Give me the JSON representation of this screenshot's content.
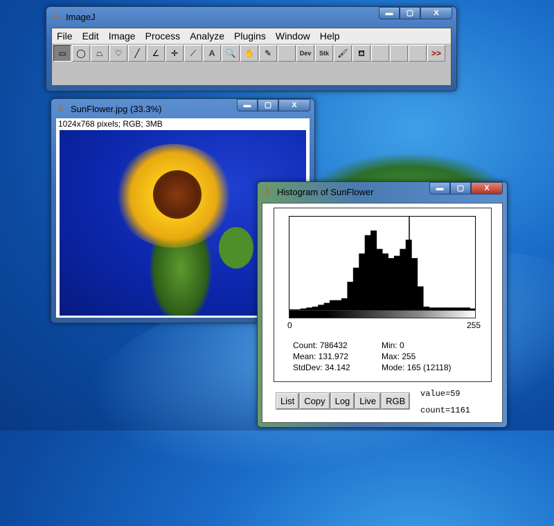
{
  "imagej": {
    "title": "ImageJ",
    "menu": [
      "File",
      "Edit",
      "Image",
      "Process",
      "Analyze",
      "Plugins",
      "Window",
      "Help"
    ],
    "tools": [
      {
        "icon": "rectangle-icon",
        "glyph": "▭"
      },
      {
        "icon": "oval-icon",
        "glyph": "◯"
      },
      {
        "icon": "polygon-icon",
        "glyph": "⏢"
      },
      {
        "icon": "freehand-icon",
        "glyph": "♡"
      },
      {
        "icon": "line-icon",
        "glyph": "╱"
      },
      {
        "icon": "angle-icon",
        "glyph": "∠"
      },
      {
        "icon": "point-icon",
        "glyph": "✛"
      },
      {
        "icon": "wand-icon",
        "glyph": "⟋"
      },
      {
        "icon": "text-icon",
        "glyph": "A"
      },
      {
        "icon": "magnifier-icon",
        "glyph": "🔍"
      },
      {
        "icon": "hand-icon",
        "glyph": "✋"
      },
      {
        "icon": "dropper-icon",
        "glyph": "✎"
      },
      {
        "icon": "empty",
        "glyph": ""
      },
      {
        "icon": "dev-icon",
        "glyph": "Dev"
      },
      {
        "icon": "stk-icon",
        "glyph": "Stk"
      },
      {
        "icon": "brush-icon",
        "glyph": "🖌"
      },
      {
        "icon": "fill-icon",
        "glyph": "⛾"
      },
      {
        "icon": "empty",
        "glyph": ""
      },
      {
        "icon": "empty",
        "glyph": ""
      },
      {
        "icon": "empty",
        "glyph": ""
      },
      {
        "icon": "more-icon",
        "glyph": ">>"
      }
    ]
  },
  "image_window": {
    "title": "SunFlower.jpg (33.3%)",
    "info": "1024x768 pixels; RGB; 3MB"
  },
  "histogram": {
    "title": "Histogram of SunFlower",
    "axis_min": "0",
    "axis_max": "255",
    "stats": {
      "count": "Count: 786432",
      "mean": "Mean: 131.972",
      "stddev": "StdDev: 34.142",
      "min": "Min: 0",
      "max": "Max: 255",
      "mode": "Mode: 165 (12118)"
    },
    "buttons": [
      "List",
      "Copy",
      "Log",
      "Live",
      "RGB"
    ],
    "value": "value=59",
    "count": "count=1161"
  },
  "chart_data": {
    "type": "bar",
    "xlim": [
      0,
      255
    ],
    "bin_width": 8,
    "values": [
      0,
      0,
      120,
      240,
      360,
      600,
      850,
      1200,
      1200,
      1450,
      3600,
      5450,
      7300,
      9700,
      10300,
      7900,
      7300,
      6700,
      7000,
      7900,
      9100,
      6700,
      3000,
      360,
      240,
      240,
      240,
      240,
      240,
      240,
      240,
      120
    ],
    "mode": {
      "x": 165,
      "count": 12118
    }
  },
  "colors": {
    "titlebar": "#3a6db5",
    "desktop": "#1a6cc8"
  }
}
